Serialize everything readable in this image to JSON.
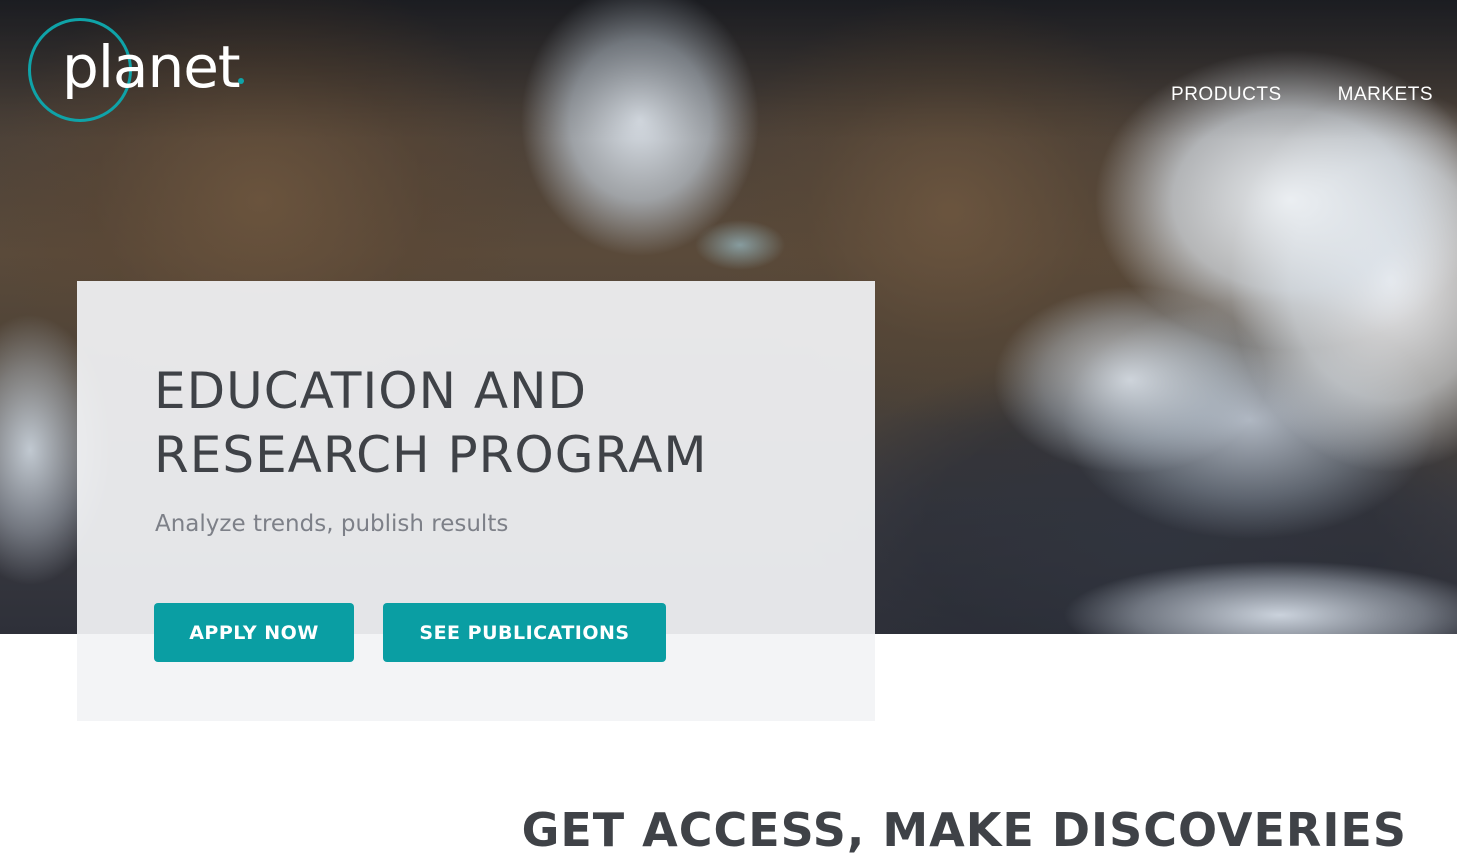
{
  "header": {
    "logo_text": "planet",
    "nav": [
      {
        "label": "PRODUCTS"
      },
      {
        "label": "MARKETS"
      }
    ]
  },
  "hero": {
    "title_line1": "EDUCATION AND",
    "title_line2": "RESEARCH PROGRAM",
    "subtitle": "Analyze trends, publish results",
    "buttons": {
      "apply": "APPLY NOW",
      "publications": "SEE PUBLICATIONS"
    }
  },
  "section": {
    "heading": "GET ACCESS, MAKE DISCOVERIES"
  },
  "colors": {
    "accent": "#0a9ea3",
    "heading_text": "#3f4247",
    "card_bg": "#f2f3f5"
  }
}
